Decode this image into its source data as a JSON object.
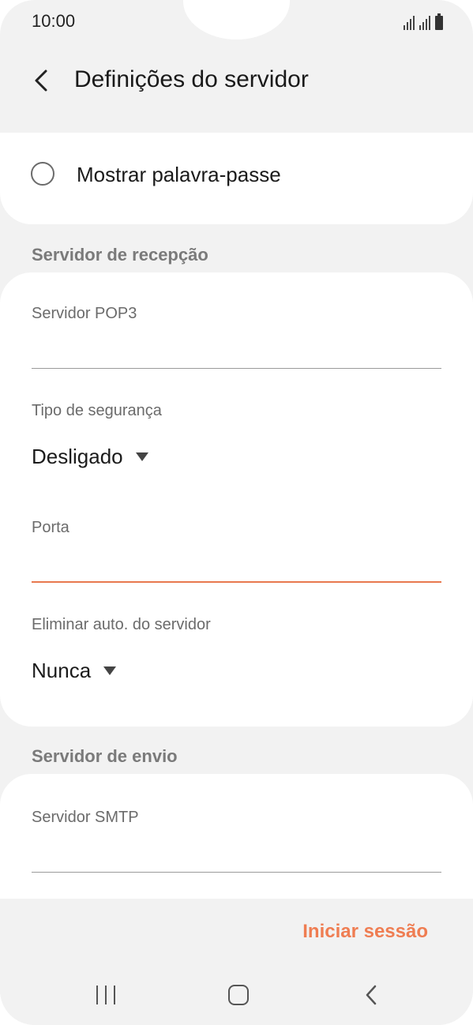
{
  "status_bar": {
    "time": "10:00",
    "icons": [
      "signal-icon",
      "signal-icon",
      "battery-icon"
    ]
  },
  "header": {
    "back_icon": "chevron-left-icon",
    "title": "Definições do servidor"
  },
  "password": {
    "checkbox_label": "Mostrar palavra-passe",
    "checked": false
  },
  "incoming": {
    "section_title": "Servidor de recepção",
    "server_label": "Servidor POP3",
    "server_value": "",
    "security_label": "Tipo de segurança",
    "security_value": "Desligado",
    "port_label": "Porta",
    "port_value": "",
    "delete_label": "Eliminar auto. do servidor",
    "delete_value": "Nunca"
  },
  "outgoing": {
    "section_title": "Servidor de envio",
    "server_label": "Servidor SMTP",
    "server_value": ""
  },
  "actions": {
    "sign_in_label": "Iniciar sessão"
  },
  "nav": {
    "recent_icon": "recent-apps-icon",
    "home_icon": "home-icon",
    "back_icon": "back-icon"
  },
  "colors": {
    "accent": "#ef7d52",
    "background": "#f2f2f2"
  }
}
